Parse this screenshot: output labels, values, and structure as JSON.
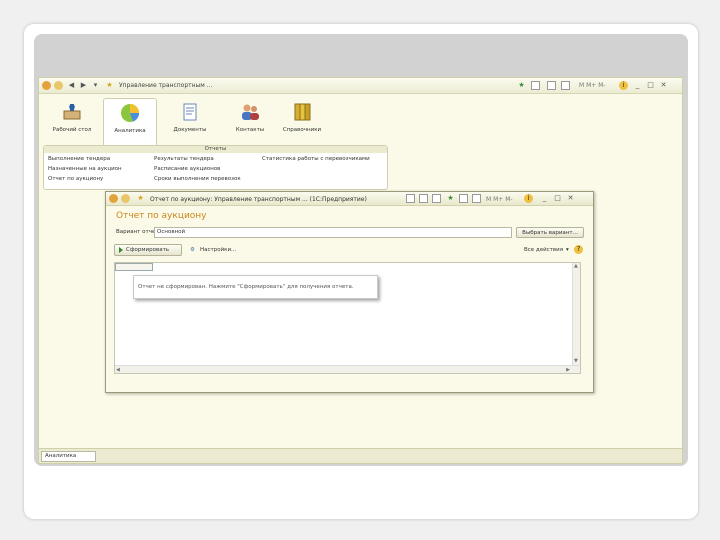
{
  "app": {
    "title": "Управление транспортным ...",
    "titlebar_right": "M M+ M-",
    "info_icon": "i"
  },
  "sections": [
    {
      "label": "Рабочий стол",
      "icon": "desktop-icon"
    },
    {
      "label": "Аналитика",
      "icon": "analytics-icon"
    },
    {
      "label": "Документы",
      "icon": "documents-icon"
    },
    {
      "label": "Контакты",
      "icon": "contacts-icon"
    },
    {
      "label": "Справочники",
      "icon": "reference-books-icon"
    }
  ],
  "reports_panel": {
    "title": "Отчеты",
    "col1": [
      "Выполнение тендера",
      "Назначенные на аукцион",
      "Отчет по аукциону"
    ],
    "col2": [
      "Результаты тендера",
      "Расписание аукционов",
      "Сроки выполнения перевозок"
    ],
    "col3": [
      "Статистика работы с перевозчиками"
    ]
  },
  "report_window": {
    "title_bar": "Отчет по аукциону: Управление транспортным ... (1С:Предприятие)",
    "heading": "Отчет по аукциону",
    "variant_label": "Вариант отчета:",
    "variant_value": "Основной",
    "choose_variant_btn": "Выбрать вариант...",
    "generate_btn": "Сформировать",
    "settings_btn": "Настройки...",
    "all_actions_btn": "Все действия",
    "hint_text": "Отчет не сформирован. Нажмите \"Сформировать\" для получения отчета.",
    "help_icon": "?"
  },
  "statusbar": {
    "tab_label": "Аналитика"
  },
  "colors": {
    "accent_title": "#c9861b",
    "app_background": "#fbfae8",
    "generate_icon": "#2d8a2d"
  }
}
